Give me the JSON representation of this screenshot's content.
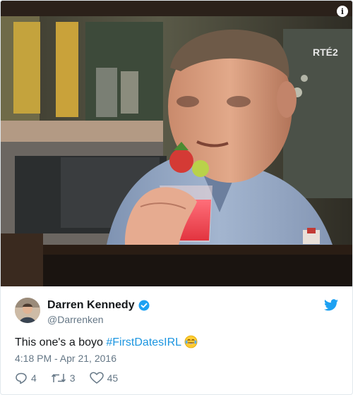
{
  "tv": {
    "channel_logo": "RTÉ2",
    "info_icon": "info-icon"
  },
  "user": {
    "name": "Darren Kennedy",
    "handle": "@Darrenken",
    "verified": true,
    "verified_icon": "verified-badge-icon",
    "avatar": "avatar"
  },
  "tweet": {
    "text_plain": "This one's a boyo ",
    "hashtag": "#FirstDatesIRL",
    "emoji": "face-with-tears-of-joy",
    "timestamp": "4:18 PM - Apr 21, 2016"
  },
  "actions": {
    "reply": {
      "icon": "reply-icon",
      "count": "4"
    },
    "retweet": {
      "icon": "retweet-icon",
      "count": "3"
    },
    "like": {
      "icon": "heart-icon",
      "count": "45"
    }
  },
  "colors": {
    "link": "#1b95e0",
    "secondary_text": "#657786",
    "verified": "#1da1f2",
    "border": "#e1e8ed"
  }
}
